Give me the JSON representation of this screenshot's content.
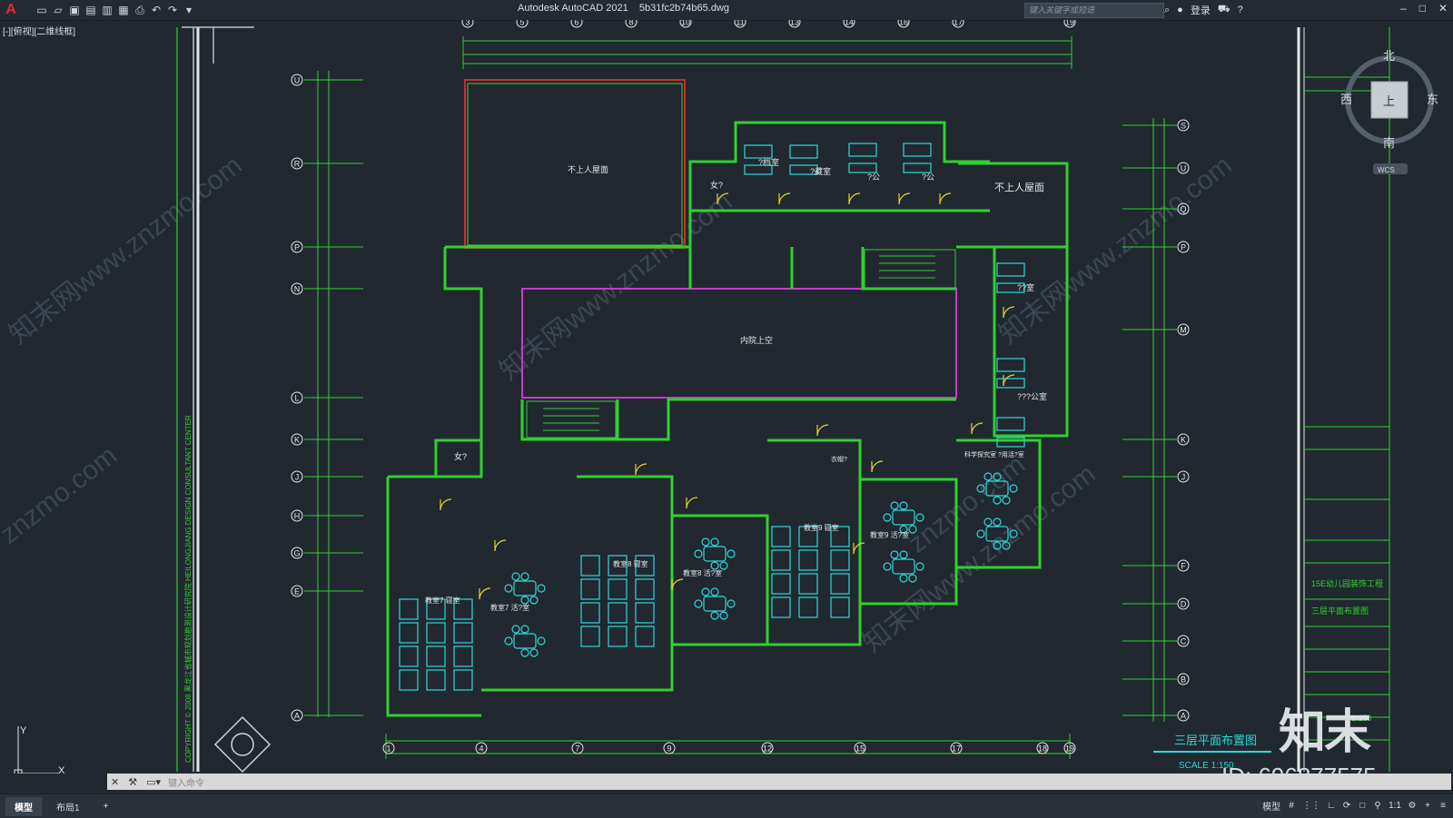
{
  "window": {
    "title": "Autodesk AutoCAD 2021    5b31fc2b74b65.dwg",
    "search_placeholder": "键入关键字或短语",
    "login_label": "登录"
  },
  "viewport": {
    "label": "[-][俯视][二维线框]"
  },
  "compass": {
    "north": "北",
    "south": "南",
    "east": "东",
    "west": "西",
    "center": "上",
    "wcs": "WCS"
  },
  "drawing": {
    "column_axes_top": [
      "3",
      "5",
      "6",
      "8",
      "10",
      "11",
      "13",
      "14",
      "16",
      "17",
      "19"
    ],
    "column_axes_bottom": [
      "1",
      "4",
      "7",
      "9",
      "12",
      "15",
      "17",
      "18",
      "19"
    ],
    "row_axes_left": [
      "U",
      "R",
      "P",
      "N",
      "L",
      "K",
      "J",
      "H",
      "G",
      "E",
      "A"
    ],
    "row_axes_right": [
      "S",
      "U",
      "Q",
      "P",
      "M",
      "K",
      "J",
      "F",
      "D",
      "C",
      "B",
      "A"
    ],
    "rooms": {
      "roof_no_access_1": "不上人屋面",
      "roof_no_access_2": "不上人屋面",
      "courtyard": "内院上空",
      "room_a": "?档室",
      "room_b": "?藏室",
      "room_c": "?公",
      "room_d": "?公",
      "room_e": "女?",
      "room_f": "??室",
      "room_g": "???公室",
      "room_h": "女?",
      "room_i": "科学探究室\n?用活?室",
      "room_j": "衣帽?",
      "room_k": "教室9\n活?室",
      "room_l": "教室8\n活?室",
      "room_m": "教室7\n活?室",
      "room_n": "教室9\n寝室",
      "room_o": "教室8\n寝室",
      "room_p": "教室7\n寝室"
    },
    "drawing_title": "三层平面布置图",
    "scale": "SCALE  1:150",
    "side_text": "COPYRIGHT © 2008 黑龙江省城市规划勘测设计研究院 HEILONGJIANG DESIGN CONSULTANT CENTER",
    "tb_project": "15E幼儿园装饰工程",
    "tb_sheet": "三层平面布置图",
    "tb_scale": "1:150"
  },
  "commandline": {
    "placeholder": "键入命令"
  },
  "statusbar": {
    "tabs": [
      "模型",
      "布局1",
      "+"
    ],
    "model_label": "模型",
    "scale": "1:1"
  },
  "watermark": {
    "brand": "知末",
    "id": "ID: 696877575",
    "site": "znzmo.com",
    "site_cn": "知末网www.znzmo.com"
  }
}
